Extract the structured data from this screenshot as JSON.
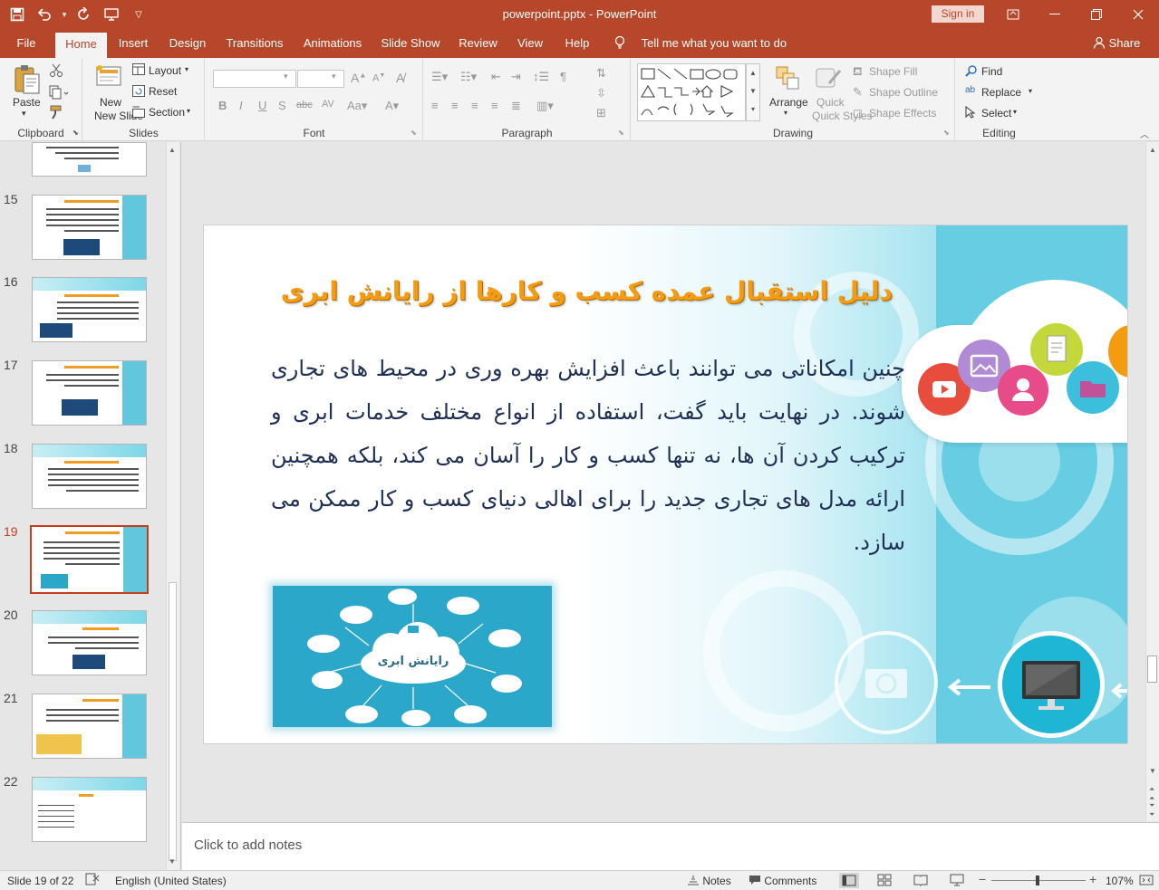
{
  "window": {
    "title": "powerpoint.pptx  -  PowerPoint",
    "signin_label": "Sign in",
    "accent_color": "#b7472a"
  },
  "menu": {
    "tabs": [
      "File",
      "Home",
      "Insert",
      "Design",
      "Transitions",
      "Animations",
      "Slide Show",
      "Review",
      "View",
      "Help"
    ],
    "active_tab": "Home",
    "tell_me": "Tell me what you want to do",
    "share": "Share"
  },
  "ribbon": {
    "clipboard": {
      "label": "Clipboard",
      "paste": "Paste"
    },
    "slides": {
      "label": "Slides",
      "new_slide": "New Slide",
      "layout": "Layout",
      "reset": "Reset",
      "section": "Section"
    },
    "font": {
      "label": "Font"
    },
    "paragraph": {
      "label": "Paragraph"
    },
    "drawing": {
      "label": "Drawing",
      "arrange": "Arrange",
      "quick_styles": "Quick Styles",
      "shape_fill": "Shape Fill",
      "shape_outline": "Shape Outline",
      "shape_effects": "Shape Effects"
    },
    "editing": {
      "label": "Editing",
      "find": "Find",
      "replace": "Replace",
      "select": "Select"
    }
  },
  "thumbnails": [
    {
      "num": "15"
    },
    {
      "num": "16"
    },
    {
      "num": "17"
    },
    {
      "num": "18"
    },
    {
      "num": "19",
      "selected": true
    },
    {
      "num": "20"
    },
    {
      "num": "21"
    },
    {
      "num": "22"
    }
  ],
  "slide": {
    "title": "دلیل استقبال عمده کسب و کارها از رایانش ابری",
    "body": "چنین امکاناتی می توانند باعث افزایش بهره وری در محیط های تجاری شوند. در نهایت باید گفت، استفاده از انواع مختلف خدمات ابری و ترکیب کردن آن ها، نه تنها کسب و کار را آسان می کند، بلکه همچنین ارائه مدل های تجاری جدید را برای اهالی دنیای کسب و کار ممکن می سازد.",
    "image_label": "رایانش ابری"
  },
  "notes": {
    "placeholder": "Click to add notes"
  },
  "status": {
    "slide_info": "Slide 19 of 22",
    "language": "English (United States)",
    "notes": "Notes",
    "comments": "Comments",
    "zoom": "107%"
  }
}
